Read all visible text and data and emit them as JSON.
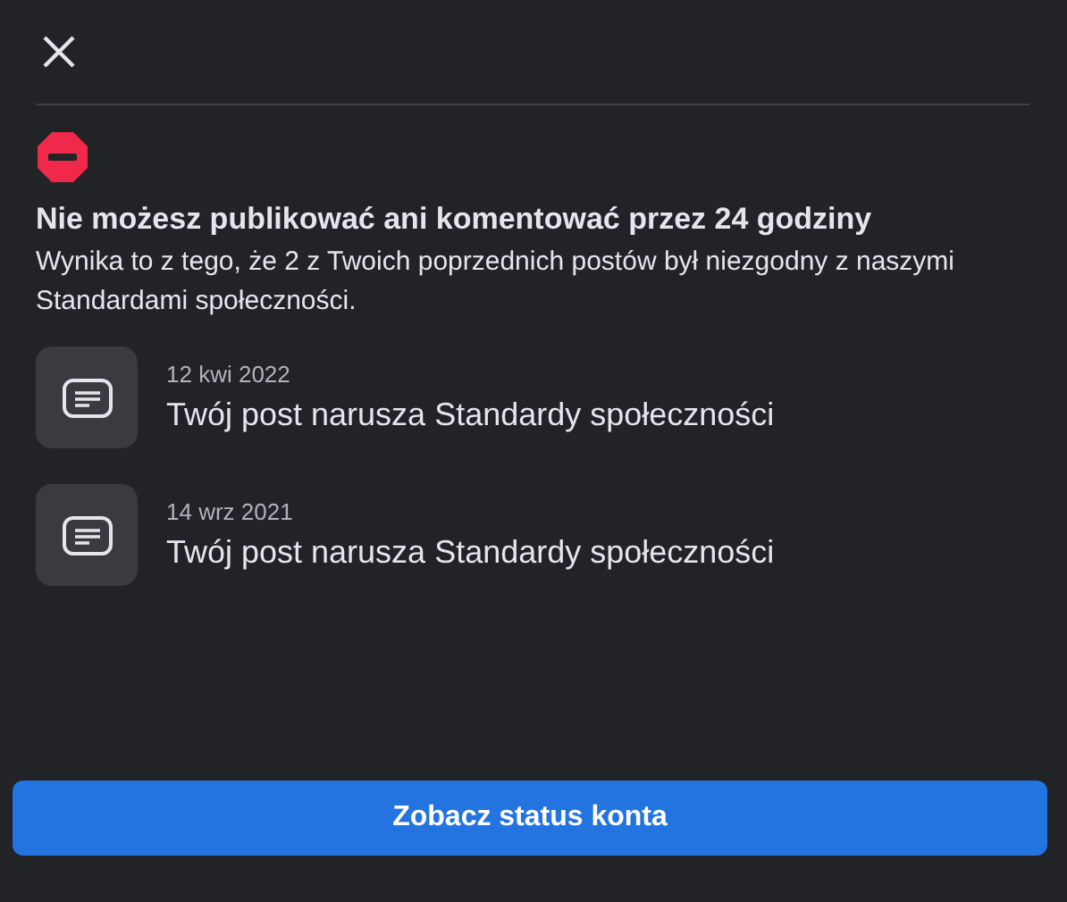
{
  "title": "Nie możesz publikować ani komentować przez 24 godziny",
  "description": "Wynika to z tego, że 2 z Twoich poprzednich postów był niezgodny z naszymi Standardami społeczności.",
  "violations": [
    {
      "date": "12 kwi 2022",
      "text": "Twój post narusza Standardy społeczności"
    },
    {
      "date": "14 wrz 2021",
      "text": "Twój post narusza Standardy społeczności"
    }
  ],
  "button": "Zobacz status konta"
}
